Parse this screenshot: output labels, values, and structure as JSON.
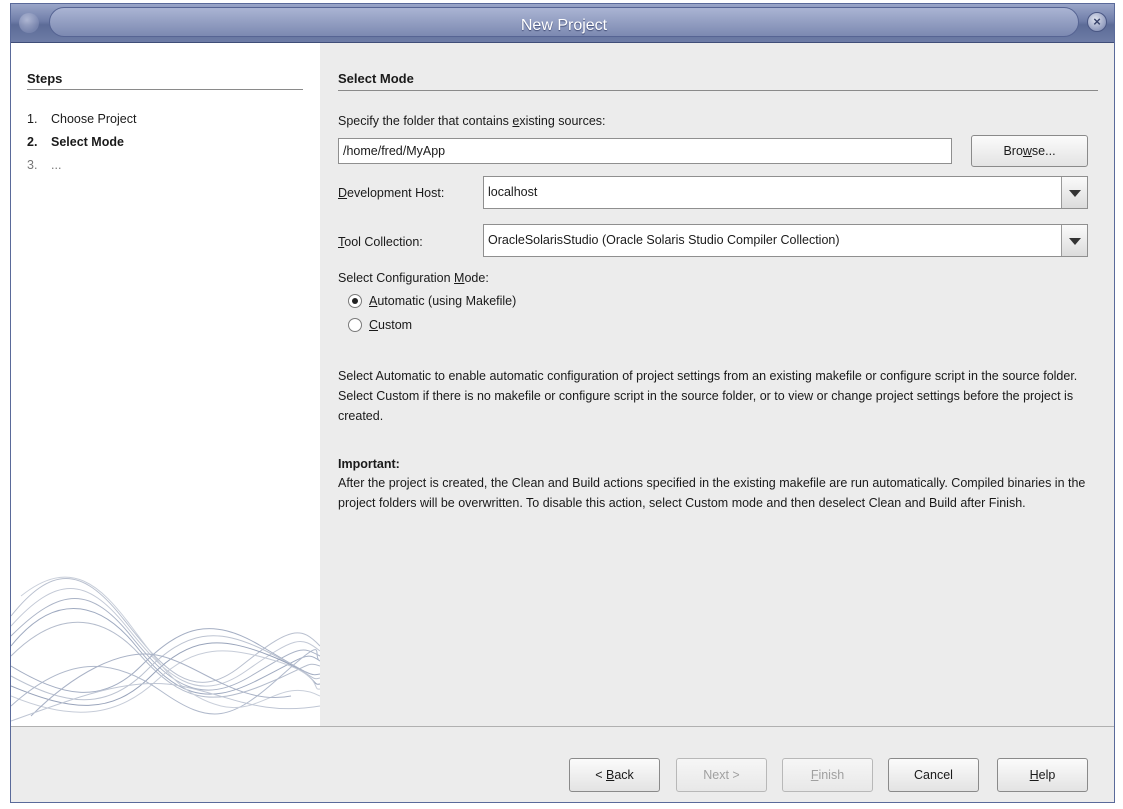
{
  "window": {
    "title": "New Project"
  },
  "steps": {
    "title": "Steps",
    "items": [
      {
        "num": "1.",
        "label": "Choose Project",
        "state": "done"
      },
      {
        "num": "2.",
        "label": "Select Mode",
        "state": "current"
      },
      {
        "num": "3.",
        "label": "...",
        "state": "pending"
      }
    ]
  },
  "main": {
    "title": "Select Mode",
    "folder": {
      "label_pre": "Specify the folder that contains ",
      "label_mn": "e",
      "label_post": "xisting sources:",
      "value": "/home/fred/MyApp",
      "browse_pre": "Bro",
      "browse_mn": "w",
      "browse_post": "se..."
    },
    "dev_host": {
      "label_mn": "D",
      "label_post": "evelopment Host:",
      "value": "localhost"
    },
    "tool_collection": {
      "label_mn": "T",
      "label_post": "ool Collection:",
      "value": "OracleSolarisStudio (Oracle Solaris Studio Compiler Collection)"
    },
    "config_mode": {
      "label_pre": "Select Configuration ",
      "label_mn": "M",
      "label_post": "ode:",
      "options": [
        {
          "mn": "A",
          "rest": "utomatic (using Makefile)",
          "selected": true
        },
        {
          "mn": "C",
          "rest": "ustom",
          "selected": false
        }
      ]
    },
    "description": "Select Automatic to enable automatic configuration of project settings from an existing makefile or configure script in the source folder. Select Custom if there is no makefile or configure script in the source folder, or to view or change project settings before the project is created.",
    "important_title": "Important:",
    "important_text": "After the project is created, the Clean and Build actions specified in the existing makefile are run automatically. Compiled binaries in the project folders will be overwritten. To disable this action, select Custom mode and then deselect Clean and Build after Finish."
  },
  "buttons": {
    "back_pre": "< ",
    "back_mn": "B",
    "back_post": "ack",
    "next": "Next >",
    "finish_mn": "F",
    "finish_post": "inish",
    "cancel": "Cancel",
    "help_mn": "H",
    "help_post": "elp"
  }
}
